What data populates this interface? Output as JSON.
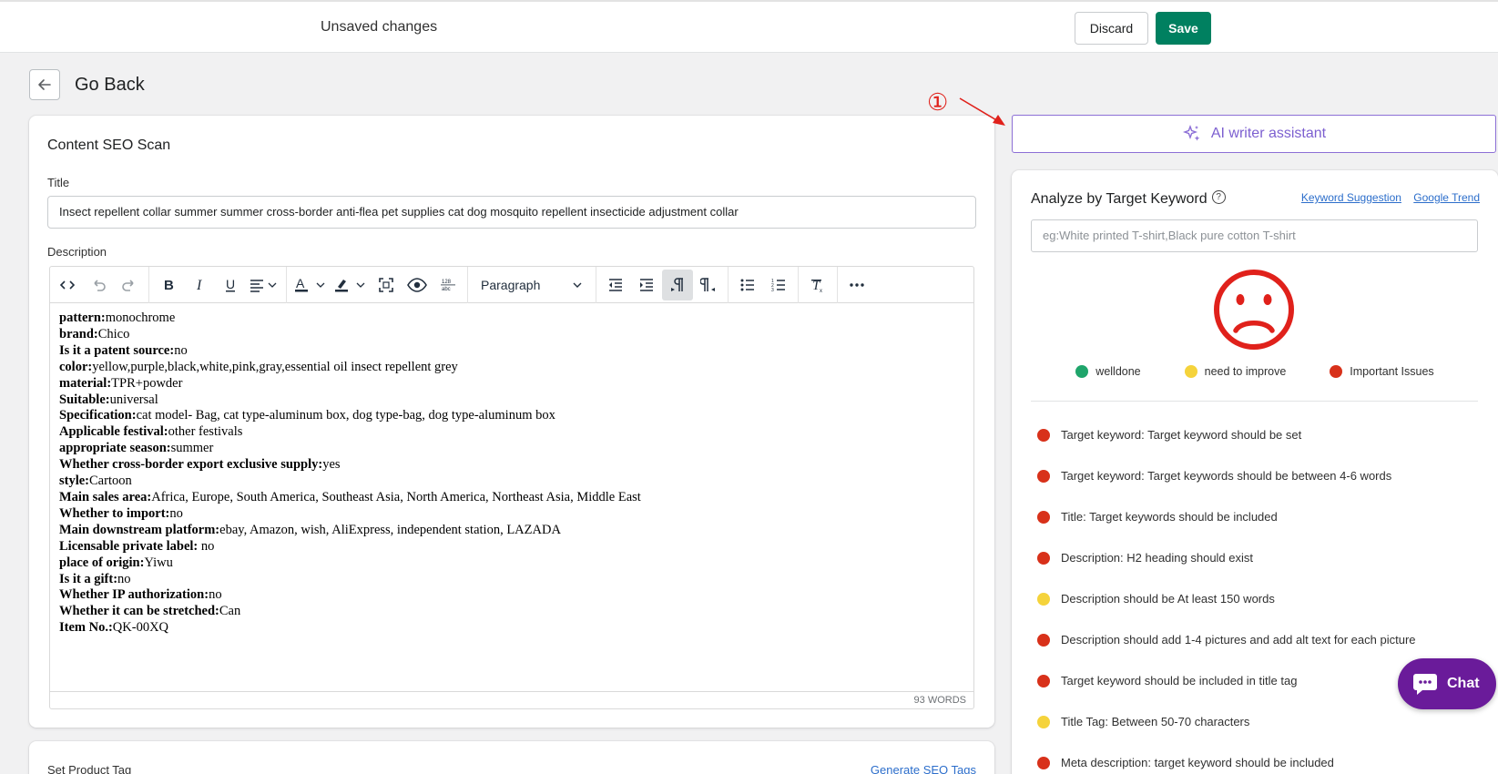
{
  "topbar": {
    "unsaved_label": "Unsaved changes",
    "discard_label": "Discard",
    "save_label": "Save"
  },
  "page": {
    "back_label": "Go Back"
  },
  "annotation": {
    "number": "①"
  },
  "seo_card": {
    "title": "Content SEO Scan",
    "title_label": "Title",
    "title_value": "Insect repellent collar summer summer cross-border anti-flea pet supplies cat dog mosquito repellent insecticide adjustment collar",
    "description_label": "Description",
    "toolbar": {
      "block_format": "Paragraph",
      "icons": [
        "source-code-icon",
        "undo-icon",
        "redo-icon",
        "bold-icon",
        "italic-icon",
        "underline-icon",
        "align-icon",
        "text-color-icon",
        "highlight-icon",
        "fullscreen-icon",
        "preview-icon",
        "word-count-icon",
        "outdent-icon",
        "indent-icon",
        "ltr-icon",
        "rtl-icon",
        "bullet-list-icon",
        "numbered-list-icon",
        "clear-format-icon",
        "more-icon"
      ]
    },
    "word_count": "93 WORDS",
    "description_rows": [
      {
        "k": "pattern:",
        "v": "monochrome"
      },
      {
        "k": "brand:",
        "v": "Chico"
      },
      {
        "k": "Is it a patent source:",
        "v": "no"
      },
      {
        "k": "color:",
        "v": "yellow,purple,black,white,pink,gray,essential oil insect repellent grey"
      },
      {
        "k": "material:",
        "v": "TPR+powder"
      },
      {
        "k": "Suitable:",
        "v": "universal"
      },
      {
        "k": "Specification:",
        "v": "cat model- Bag, cat type-aluminum box, dog type-bag, dog type-aluminum box"
      },
      {
        "k": "Applicable festival:",
        "v": "other festivals"
      },
      {
        "k": "appropriate season:",
        "v": "summer"
      },
      {
        "k": "Whether cross-border export exclusive supply:",
        "v": "yes"
      },
      {
        "k": "style:",
        "v": "Cartoon"
      },
      {
        "k": "Main sales area:",
        "v": "Africa, Europe, South America, Southeast Asia, North America, Northeast Asia, Middle East"
      },
      {
        "k": "Whether to import:",
        "v": "no"
      },
      {
        "k": "Main downstream platform:",
        "v": "ebay, Amazon, wish, AliExpress, independent station, LAZADA"
      },
      {
        "k": "Licensable private label:",
        "v": " no"
      },
      {
        "k": "place of origin:",
        "v": "Yiwu"
      },
      {
        "k": "Is it a gift:",
        "v": "no"
      },
      {
        "k": "Whether IP authorization:",
        "v": "no"
      },
      {
        "k": "Whether it can be stretched:",
        "v": "Can"
      },
      {
        "k": "Item No.:",
        "v": "QK-00XQ"
      }
    ]
  },
  "tag_card": {
    "title": "Set Product Tag",
    "link": "Generate SEO Tags"
  },
  "ai_button": {
    "label": "AI writer assistant"
  },
  "analyze": {
    "title": "Analyze by Target Keyword",
    "help": "?",
    "link_suggestion": "Keyword Suggestion",
    "link_trend": "Google Trend",
    "placeholder": "eg:White printed T-shirt,Black pure cotton T-shirt",
    "legend": {
      "good": "welldone",
      "improve": "need to improve",
      "issues": "Important Issues"
    },
    "colors": {
      "good": "#1fa56b",
      "improve": "#f5d33b",
      "issue": "#d8311a",
      "face": "#e0211b"
    },
    "items": [
      {
        "status": "red",
        "text": "Target keyword: Target keyword should be set"
      },
      {
        "status": "red",
        "text": "Target keyword: Target keywords should be between 4-6 words"
      },
      {
        "status": "red",
        "text": "Title: Target keywords should be included"
      },
      {
        "status": "red",
        "text": "Description: H2 heading should exist"
      },
      {
        "status": "yellow",
        "text": "Description should be At least 150 words"
      },
      {
        "status": "red",
        "text": "Description should add 1-4 pictures and add alt text for each picture"
      },
      {
        "status": "red",
        "text": "Target keyword should be included in title tag"
      },
      {
        "status": "yellow",
        "text": "Title Tag: Between 50-70 characters"
      },
      {
        "status": "red",
        "text": "Meta description: target keyword should be included"
      }
    ]
  },
  "chat": {
    "label": "Chat"
  }
}
